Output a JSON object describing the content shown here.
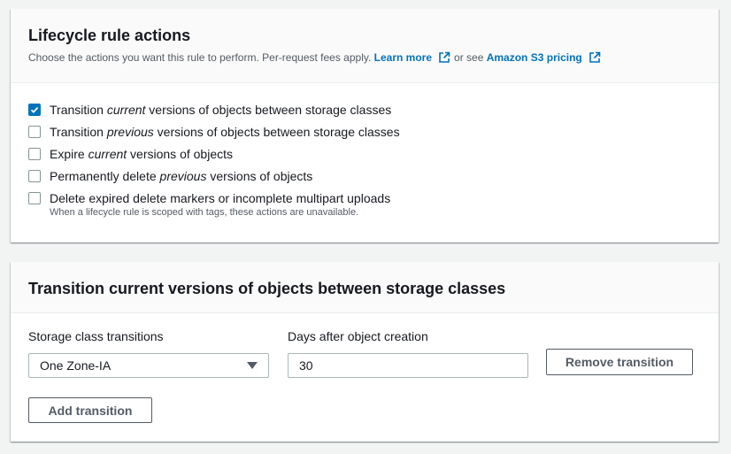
{
  "lifecycle_panel": {
    "title": "Lifecycle rule actions",
    "description_prefix": "Choose the actions you want this rule to perform. Per-request fees apply.",
    "learn_more_link": "Learn more",
    "or_see_text": "or see",
    "pricing_link": "Amazon S3 pricing",
    "actions": [
      {
        "before": "Transition ",
        "emphasis": "current",
        "after": " versions of objects between storage classes",
        "checked": true
      },
      {
        "before": "Transition ",
        "emphasis": "previous",
        "after": " versions of objects between storage classes",
        "checked": false
      },
      {
        "before": "Expire ",
        "emphasis": "current",
        "after": " versions of objects",
        "checked": false
      },
      {
        "before": "Permanently delete ",
        "emphasis": "previous",
        "after": " versions of objects",
        "checked": false
      },
      {
        "before": "Delete expired delete markers or incomplete multipart uploads",
        "emphasis": "",
        "after": "",
        "checked": false
      }
    ],
    "actions_hint": "When a lifecycle rule is scoped with tags, these actions are unavailable."
  },
  "transition_panel": {
    "title": "Transition current versions of objects between storage classes",
    "storage_class_label": "Storage class transitions",
    "storage_class_value": "One Zone-IA",
    "days_label": "Days after object creation",
    "days_value": "30",
    "remove_button": "Remove transition",
    "add_button": "Add transition"
  },
  "icons": {
    "external_link": "external-link-icon",
    "checkbox_check": "check-icon",
    "dropdown": "caret-down-icon"
  },
  "colors": {
    "link": "#0073bb",
    "checkbox_checked": "#0073bb",
    "page_background": "#f2f3f3"
  }
}
